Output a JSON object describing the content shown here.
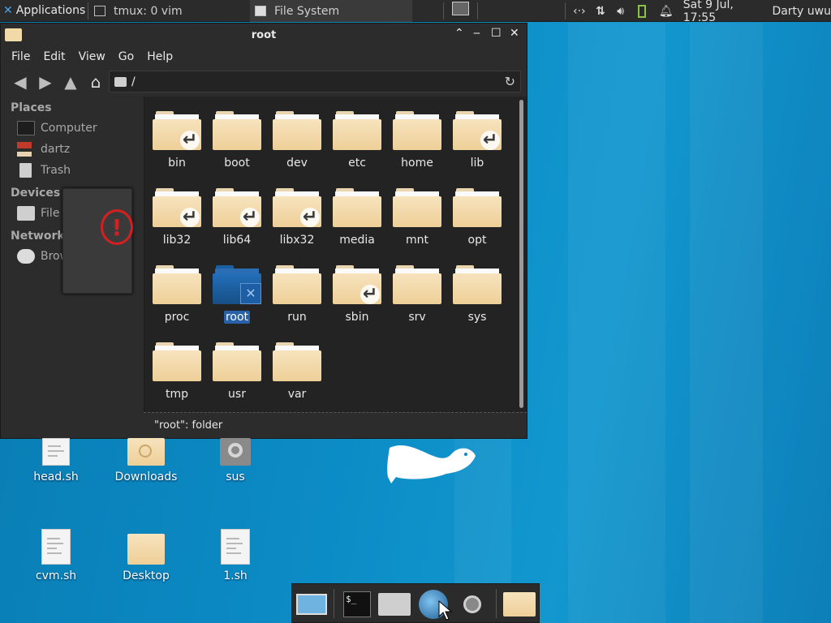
{
  "top_panel": {
    "applications_label": "Applications",
    "task1_label": "tmux: 0 vim",
    "task2_label": "File System",
    "tray": {
      "clock": "Sat  9 Jul, 17:55",
      "user": "Darty uwu"
    }
  },
  "window": {
    "title": "root",
    "menu": [
      "File",
      "Edit",
      "View",
      "Go",
      "Help"
    ],
    "path": "/",
    "sidebar": {
      "places_heading": "Places",
      "places": [
        "Computer",
        "dartz",
        "Trash"
      ],
      "devices_heading": "Devices",
      "devices": [
        "File"
      ],
      "network_heading": "Network",
      "network": [
        "Brow"
      ]
    },
    "folders": [
      {
        "name": "bin",
        "link": true
      },
      {
        "name": "boot",
        "link": false
      },
      {
        "name": "dev",
        "link": false
      },
      {
        "name": "etc",
        "link": false
      },
      {
        "name": "home",
        "link": false
      },
      {
        "name": "lib",
        "link": true
      },
      {
        "name": "lib32",
        "link": true
      },
      {
        "name": "lib64",
        "link": true
      },
      {
        "name": "libx32",
        "link": true
      },
      {
        "name": "media",
        "link": false
      },
      {
        "name": "mnt",
        "link": false
      },
      {
        "name": "opt",
        "link": false
      },
      {
        "name": "proc",
        "link": false
      },
      {
        "name": "root",
        "link": false,
        "selected": true
      },
      {
        "name": "run",
        "link": false
      },
      {
        "name": "sbin",
        "link": true
      },
      {
        "name": "srv",
        "link": false
      },
      {
        "name": "sys",
        "link": false
      },
      {
        "name": "tmp",
        "link": false
      },
      {
        "name": "usr",
        "link": false
      },
      {
        "name": "var",
        "link": false
      }
    ],
    "status": "\"root\": folder"
  },
  "desktop": {
    "icons": [
      "head.sh",
      "Downloads",
      "sus",
      "cvm.sh",
      "Desktop",
      "1.sh"
    ]
  },
  "colors": {
    "desktop_bg": "#0b8ac4",
    "panel_bg": "#2b2b2b",
    "selection": "#2961a8",
    "folder": "#f7e3bd"
  },
  "icons": {
    "back": "arrow-left-icon",
    "forward": "arrow-right-icon",
    "up": "arrow-up-icon",
    "home": "home-icon",
    "reload": "reload-icon",
    "error": "error-icon"
  }
}
